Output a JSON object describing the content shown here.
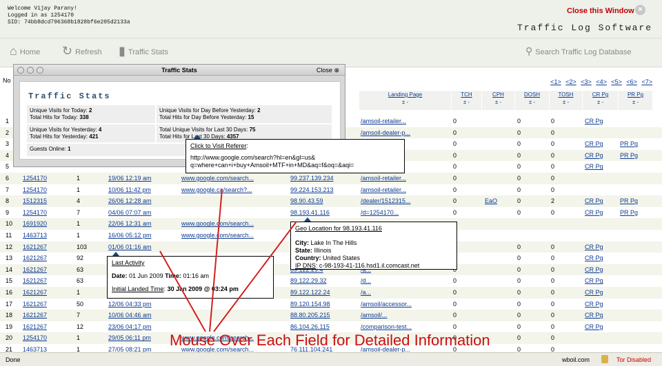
{
  "header": {
    "welcome_line": "Welcome Vijay Parany!",
    "logged_line": "Logged in as 1254170",
    "sid_line": "SID: 74bb8dcd796368b1828bf6e205d2133a",
    "close_window": "Close this Window",
    "app_title": "Traffic Log Software"
  },
  "toolbar": {
    "home": "Home",
    "refresh": "Refresh",
    "traffic_stats": "Traffic Stats",
    "search": "Search Traffic Log Database"
  },
  "grid": {
    "no_label": "No",
    "pager": [
      "<1>",
      "<2>",
      "<3>",
      "<4>",
      "<5>",
      "<6>",
      "<7>"
    ],
    "headers": [
      {
        "label": "Landing Page",
        "pm": "±   -"
      },
      {
        "label": "TCH",
        "pm": "±   -"
      },
      {
        "label": "CPH",
        "pm": "±   -"
      },
      {
        "label": "DOSH",
        "pm": "±   -"
      },
      {
        "label": "TOSH",
        "pm": "±   -"
      },
      {
        "label": "CR Pg",
        "pm": "±   -"
      },
      {
        "label": "PR Pg",
        "pm": "±   -"
      }
    ],
    "rows": [
      {
        "no": "1",
        "id": "",
        "hits": "",
        "date": "",
        "ref": "",
        "ip": "",
        "page": "/amsoil-retailer...",
        "tch": "0",
        "cph": "",
        "dosh": "0",
        "tosh": "0",
        "cr": "CR Pg",
        "pr": ""
      },
      {
        "no": "2",
        "id": "",
        "hits": "",
        "date": "",
        "ref": "",
        "ip": "",
        "page": "/amsoil-dealer-p...",
        "tch": "0",
        "cph": "",
        "dosh": "0",
        "tosh": "0",
        "cr": "",
        "pr": ""
      },
      {
        "no": "3",
        "id": "",
        "hits": "",
        "date": "",
        "ref": "",
        "ip": "",
        "page": "",
        "tch": "0",
        "cph": "",
        "dosh": "0",
        "tosh": "0",
        "cr": "CR Pg",
        "pr": "PR Pg"
      },
      {
        "no": "4",
        "id": "",
        "hits": "",
        "date": "",
        "ref": "",
        "ip": "",
        "page": "",
        "tch": "0",
        "cph": "",
        "dosh": "0",
        "tosh": "0",
        "cr": "CR Pg",
        "pr": "PR Pg"
      },
      {
        "no": "5",
        "id": "",
        "hits": "",
        "date": "",
        "ref": "",
        "ip": "",
        "page": "",
        "tch": "0",
        "cph": "",
        "dosh": "0",
        "tosh": "0",
        "cr": "CR Pg",
        "pr": ""
      },
      {
        "no": "6",
        "id": "1254170",
        "hits": "1",
        "date": "19/06 12:19 am",
        "ref": "www.google.com/search...",
        "ip": "99.237.139.234",
        "page": "/amsoil-retailer...",
        "tch": "0",
        "cph": "",
        "dosh": "0",
        "tosh": "0",
        "cr": "",
        "pr": ""
      },
      {
        "no": "7",
        "id": "1254170",
        "hits": "1",
        "date": "10/06 11:42 pm",
        "ref": "www.google.ca/search?...",
        "ip": "99.224.153.213",
        "page": "/amsoil-retailer...",
        "tch": "0",
        "cph": "",
        "dosh": "0",
        "tosh": "0",
        "cr": "",
        "pr": ""
      },
      {
        "no": "8",
        "id": "1512315",
        "hits": "4",
        "date": "26/06 12:28 am",
        "ref": "",
        "ip": "98.90.43.59",
        "page": "/dealer/1512315...",
        "tch": "0",
        "cph": "EaO",
        "dosh": "0",
        "tosh": "2",
        "cr": "CR Pg",
        "pr": "PR Pg"
      },
      {
        "no": "9",
        "id": "1254170",
        "hits": "7",
        "date": "04/06 07:07 am",
        "ref": "",
        "ip": "98.193.41.116",
        "page": "/d=1254170...",
        "tch": "0",
        "cph": "",
        "dosh": "0",
        "tosh": "0",
        "cr": "CR Pg",
        "pr": "PR Pg"
      },
      {
        "no": "10",
        "id": "1691920",
        "hits": "1",
        "date": "22/06 12:31 am",
        "ref": "www.google.com/search...",
        "ip": "",
        "page": "",
        "tch": "",
        "cph": "",
        "dosh": "",
        "tosh": "",
        "cr": "",
        "pr": ""
      },
      {
        "no": "11",
        "id": "1463713",
        "hits": "1",
        "date": "16/06 05:12 pm",
        "ref": "www.google.com/search...",
        "ip": "",
        "page": "",
        "tch": "",
        "cph": "",
        "dosh": "",
        "tosh": "",
        "cr": "",
        "pr": ""
      },
      {
        "no": "12",
        "id": "1621267",
        "hits": "103",
        "date": "01/06 01:16 am",
        "ref": "",
        "ip": "",
        "page": "",
        "tch": "0",
        "cph": "",
        "dosh": "0",
        "tosh": "0",
        "cr": "CR Pg",
        "pr": ""
      },
      {
        "no": "13",
        "id": "1621267",
        "hits": "92",
        "date": "",
        "ref": "",
        "ip": "",
        "page": "",
        "tch": "0",
        "cph": "",
        "dosh": "0",
        "tosh": "0",
        "cr": "CR Pg",
        "pr": ""
      },
      {
        "no": "14",
        "id": "1621267",
        "hits": "63",
        "date": "",
        "ref": "",
        "ip": "89.122.29.4",
        "page": "/a...",
        "tch": "0",
        "cph": "",
        "dosh": "0",
        "tosh": "0",
        "cr": "CR Pg",
        "pr": ""
      },
      {
        "no": "15",
        "id": "1621267",
        "hits": "63",
        "date": "",
        "ref": "",
        "ip": "89.122.29.32",
        "page": "/d...",
        "tch": "0",
        "cph": "",
        "dosh": "0",
        "tosh": "0",
        "cr": "CR Pg",
        "pr": ""
      },
      {
        "no": "16",
        "id": "1621267",
        "hits": "1",
        "date": "",
        "ref": "",
        "ip": "89.122.122.24",
        "page": "/a...",
        "tch": "0",
        "cph": "",
        "dosh": "0",
        "tosh": "0",
        "cr": "CR Pg",
        "pr": ""
      },
      {
        "no": "17",
        "id": "1621267",
        "hits": "50",
        "date": "12/06 04:33 pm",
        "ref": "",
        "ip": "89.120.154.98",
        "page": "/amsoil/accessor...",
        "tch": "0",
        "cph": "",
        "dosh": "0",
        "tosh": "0",
        "cr": "CR Pg",
        "pr": ""
      },
      {
        "no": "18",
        "id": "1621267",
        "hits": "7",
        "date": "10/06 04:46 am",
        "ref": "",
        "ip": "88.80.205.215",
        "page": "/amsoil/...",
        "tch": "0",
        "cph": "",
        "dosh": "0",
        "tosh": "0",
        "cr": "CR Pg",
        "pr": ""
      },
      {
        "no": "19",
        "id": "1621267",
        "hits": "12",
        "date": "23/06 04:17 pm",
        "ref": "",
        "ip": "86.104.26.115",
        "page": "/comparison-test...",
        "tch": "0",
        "cph": "",
        "dosh": "0",
        "tosh": "0",
        "cr": "CR Pg",
        "pr": ""
      },
      {
        "no": "20",
        "id": "1254170",
        "hits": "1",
        "date": "29/05 06:11 pm",
        "ref": "www.google.com/search...",
        "ip": "",
        "page": "",
        "tch": "0",
        "cph": "",
        "dosh": "0",
        "tosh": "0",
        "cr": "",
        "pr": ""
      },
      {
        "no": "21",
        "id": "1463713",
        "hits": "1",
        "date": "27/05 08:21 pm",
        "ref": "www.google.com/search...",
        "ip": "76.111.104.241",
        "page": "/amsoil-dealer-p...",
        "tch": "0",
        "cph": "",
        "dosh": "0",
        "tosh": "0",
        "cr": "",
        "pr": ""
      }
    ]
  },
  "popup": {
    "title": "Traffic Stats",
    "close": "Close",
    "heading": "Traffic Stats",
    "box1_l1": "Unique Visits for Today:",
    "box1_v1": "2",
    "box1_l2": "Total Hits for Today:",
    "box1_v2": "338",
    "box2_l1": "Unique Visits for Day Before Yesterday:",
    "box2_v1": "2",
    "box2_l2": "Total Hits for Day Before Yesterday:",
    "box2_v2": "15",
    "box3_l1": "Unique Visits for Yesterday:",
    "box3_v1": "4",
    "box3_l2": "Total Hits for Yesterday:",
    "box3_v2": "421",
    "box4_l1": "Total Unique Visits for Last 30 Days:",
    "box4_v1": "75",
    "box4_l2": "Total Hits for Last 30 Days:",
    "box4_v2": "4357",
    "guests_label": "Guests Online:",
    "guests_value": "1"
  },
  "tip_referer": {
    "title": "Click to Visit Referer",
    "title_colon": ":",
    "url_line1": "http://www.google.com/search?hl=en&gl=us&",
    "url_line2": "q=where+can+i+buy+Amsoil+MTF+in+MD&aq=f&oq=&aqi="
  },
  "tip_geo": {
    "title": "Geo Location for 98.193.41.116",
    "city_label": "City:",
    "city": "Lake In The Hills",
    "state_label": "State:",
    "state": "Illinois",
    "country_label": "Country:",
    "country": "United States",
    "ipdns_label": "IP DNS",
    "ipdns_colon": ":",
    "ipdns": "c-98-193-41-116.hsd1.il.comcast.net"
  },
  "tip_activity": {
    "title": "Last Activity",
    "date_label": "Date:",
    "date": "01 Jun 2009",
    "time_label": "Time:",
    "time": "01:16 am",
    "landed_label": "Initial Landed Time",
    "landed_colon": ":",
    "landed": "30 Jan 2009 @ 03:24 pm"
  },
  "annotation": "Mouse Over Each Field for Detailed Information",
  "status": {
    "left": "Done",
    "host": "wboil.com",
    "tor": "Tor Disabled"
  }
}
